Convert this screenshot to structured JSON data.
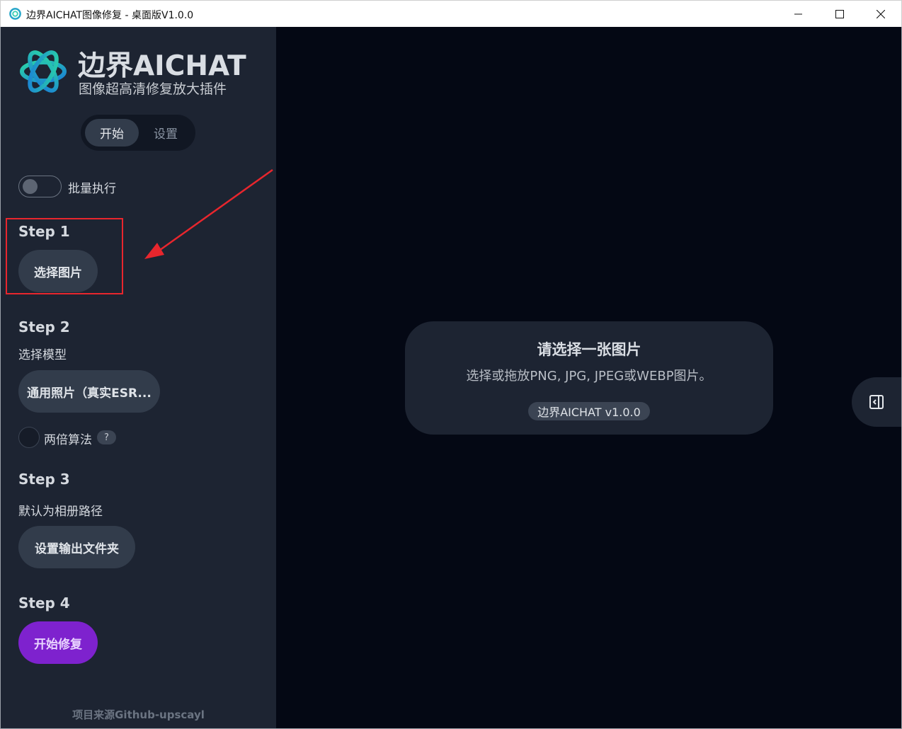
{
  "window": {
    "title": "边界AICHAT图像修复 - 桌面版V1.0.0",
    "controls": [
      "minimize",
      "maximize",
      "close"
    ]
  },
  "brand": {
    "name": "边界AICHAT",
    "subtitle": "图像超高清修复放大插件"
  },
  "tabs": {
    "start": "开始",
    "settings": "设置",
    "active": "开始"
  },
  "batch": {
    "label": "批量执行",
    "enabled": false
  },
  "steps": {
    "step1": {
      "title": "Step 1",
      "button": "选择图片"
    },
    "step2": {
      "title": "Step 2",
      "desc": "选择模型",
      "model_button": "通用照片（真实ESR...",
      "double_label": "两倍算法",
      "help": "?"
    },
    "step3": {
      "title": "Step 3",
      "desc": "默认为相册路径",
      "button": "设置输出文件夹"
    },
    "step4": {
      "title": "Step 4",
      "button": "开始修复"
    }
  },
  "footer": "项目来源Github-upscayl",
  "main": {
    "empty_title": "请选择一张图片",
    "empty_desc": "选择或拖放PNG, JPG, JPEG或WEBP图片。",
    "version": "边界AICHAT v1.0.0"
  },
  "colors": {
    "sidebar_bg": "#1d2432",
    "main_bg": "#040814",
    "button_bg": "#323c4b",
    "accent": "#7e22ce",
    "annotation_red": "#e8262d"
  },
  "icons": {
    "app": "app-logo-icon",
    "side_toggle": "sidebar-collapse-icon"
  }
}
